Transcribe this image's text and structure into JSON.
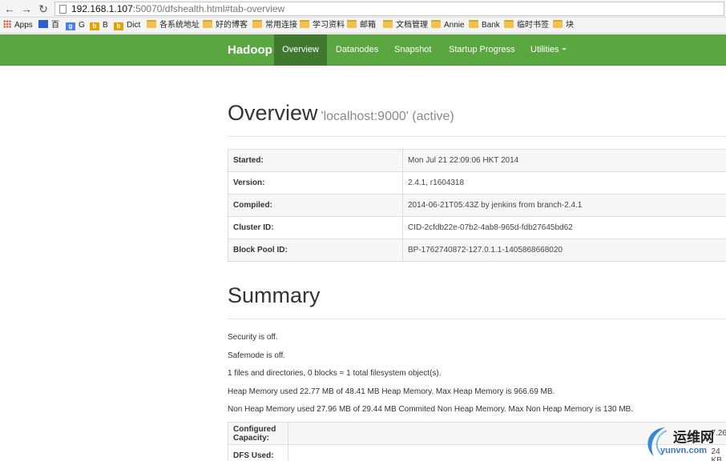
{
  "browser": {
    "url_host": "192.168.1.107",
    "url_rest": ":50070/dfshealth.html#tab-overview",
    "bookmarks": [
      "Apps",
      "百",
      "G",
      "B",
      "Dict",
      "各系统地址",
      "好的博客",
      "常用连接",
      "学习资料",
      "邮箱",
      "文档管理",
      "Annie",
      "Bank",
      "临时书签",
      "块"
    ]
  },
  "navbar": {
    "brand": "Hadoop",
    "items": [
      {
        "label": "Overview",
        "active": true
      },
      {
        "label": "Datanodes"
      },
      {
        "label": "Snapshot"
      },
      {
        "label": "Startup Progress"
      },
      {
        "label": "Utilities"
      }
    ]
  },
  "overview": {
    "title": "Overview",
    "subtitle": "'localhost:9000' (active)",
    "rows": [
      {
        "key": "Started:",
        "value": "Mon Jul 21 22:09:06 HKT 2014"
      },
      {
        "key": "Version:",
        "value": "2.4.1, r1604318"
      },
      {
        "key": "Compiled:",
        "value": "2014-06-21T05:43Z by jenkins from branch-2.4.1"
      },
      {
        "key": "Cluster ID:",
        "value": "CID-2cfdb22e-07b2-4ab8-965d-fdb27645bd62"
      },
      {
        "key": "Block Pool ID:",
        "value": "BP-1762740872-127.0.1.1-1405868668020"
      }
    ]
  },
  "summary": {
    "title": "Summary",
    "lines": [
      "Security is off.",
      "Safemode is off.",
      "1 files and directories, 0 blocks = 1 total filesystem object(s).",
      "Heap Memory used 22.77 MB of 48.41 MB Heap Memory. Max Heap Memory is 966.69 MB.",
      "Non Heap Memory used 27.96 MB of 29.44 MB Commited Non Heap Memory. Max Non Heap Memory is 130 MB."
    ],
    "rows": [
      {
        "key": "Configured Capacity:",
        "value": "7.26"
      },
      {
        "key": "DFS Used:",
        "value": "24 KB"
      }
    ]
  },
  "watermark": {
    "name": "运维网",
    "url": "yunvn.com"
  }
}
